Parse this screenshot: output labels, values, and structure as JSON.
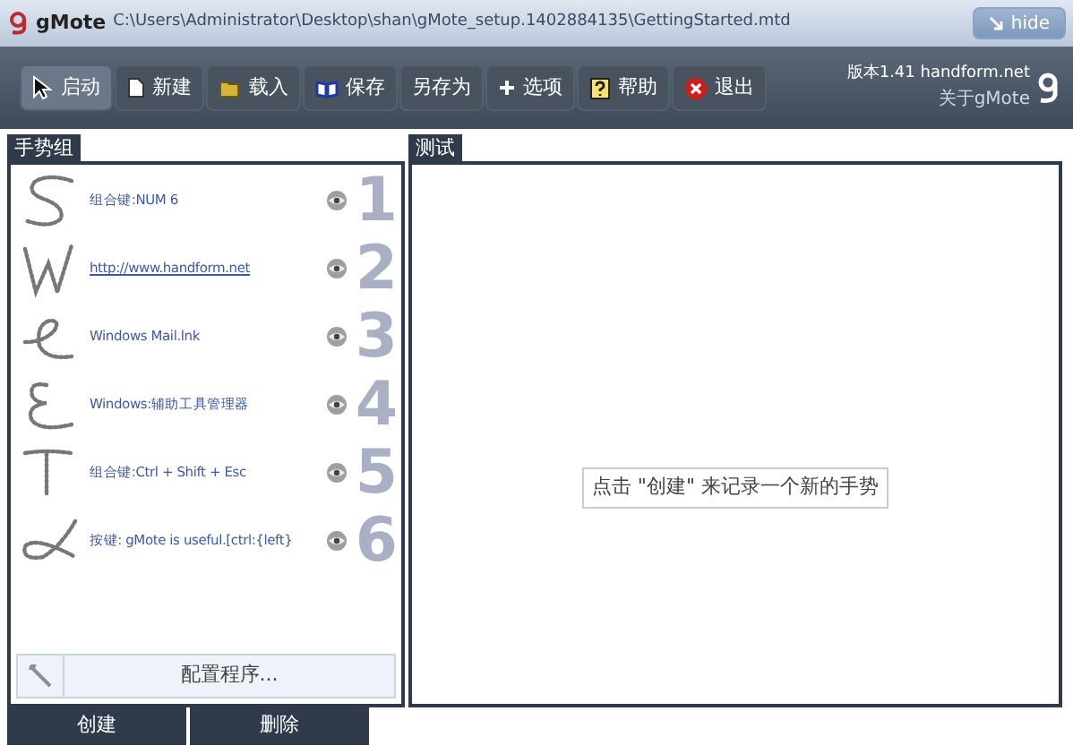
{
  "window": {
    "app_name": "gMote",
    "path": "C:\\Users\\Administrator\\Desktop\\shan\\gMote_setup.1402884135\\GettingStarted.mtd",
    "hide_button": "hide"
  },
  "toolbar": [
    {
      "label": "启动",
      "selected": true
    },
    {
      "label": "新建",
      "selected": false
    },
    {
      "label": "载入",
      "selected": false
    },
    {
      "label": "保存",
      "selected": false
    },
    {
      "label": "另存为",
      "selected": false
    },
    {
      "label": "选项",
      "selected": false
    },
    {
      "label": "帮助",
      "selected": false
    },
    {
      "label": "退出",
      "selected": false
    }
  ],
  "about": {
    "version": "版本1.41 handform.net",
    "link": "关于gMote"
  },
  "gesture_panel": {
    "title": "手势组",
    "gestures": [
      {
        "action": "组合键:NUM 6",
        "number": "1",
        "kind": "text"
      },
      {
        "action": "http://www.handform.net",
        "number": "2",
        "kind": "link"
      },
      {
        "action": "Windows Mail.lnk",
        "number": "3",
        "kind": "text"
      },
      {
        "action": "Windows:辅助工具管理器",
        "number": "4",
        "kind": "text"
      },
      {
        "action": "组合键:Ctrl + Shift + Esc",
        "number": "5",
        "kind": "text"
      },
      {
        "action": "按键: gMote is useful.[ctrl:{left}",
        "number": "6",
        "kind": "text"
      }
    ],
    "configure_button": "配置程序..."
  },
  "test_panel": {
    "title": "测试",
    "hint": "点击 \"创建\" 来记录一个新的手势"
  },
  "bottom_buttons": [
    "创建",
    "删除"
  ]
}
